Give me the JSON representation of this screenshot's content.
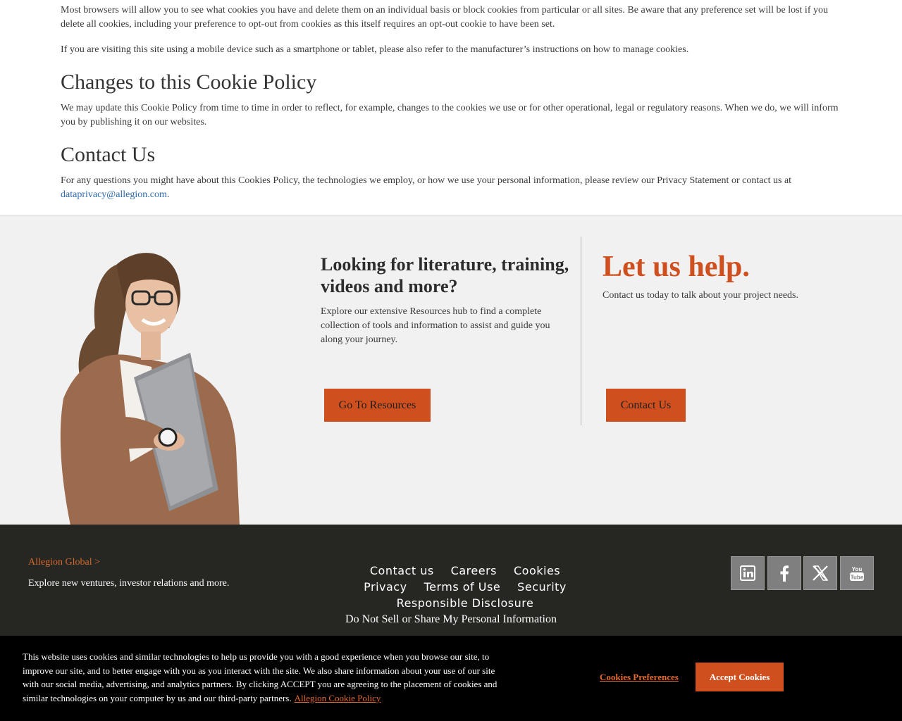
{
  "article": {
    "p1": "Most browsers will allow you to see what cookies you have and delete them on an individual basis or block cookies from particular or all sites. Be aware that any preference set will be lost if you delete all cookies, including your preference to opt-out from cookies as this itself requires an opt-out cookie to have been set.",
    "p2": "If you are visiting this site using a mobile device such as a smartphone or tablet, please also refer to the manufacturer’s instructions on how to manage cookies.",
    "changes_heading": "Changes to this Cookie Policy",
    "p3": "We may update this Cookie Policy from time to time in order to reflect, for example, changes to the cookies we use or for other operational, legal or regulatory reasons. When we do, we will inform you by publishing it on our websites.",
    "contact_heading": "Contact Us",
    "p4_text": "For any questions you might have about this Cookies Policy, the technologies we employ, or how we use your personal information, please review our Privacy Statement or contact us at",
    "p4_email": "dataprivacy@allegion.com",
    "p4_end": "."
  },
  "promo": {
    "resources_title": "Looking for literature, training, videos and more?",
    "resources_text": "Explore our extensive Resources hub to find a complete collection of tools and information to assist and guide you along your journey.",
    "resources_button": "Go To Resources",
    "help_title": "Let us help.",
    "help_text": "Contact us today to talk about your project needs.",
    "contact_button": "Contact Us"
  },
  "footer": {
    "global_link": "Allegion Global >",
    "global_text": "Explore new ventures, investor relations and more.",
    "links_row1": [
      "Contact us",
      "Careers",
      "Cookies"
    ],
    "links_row2": [
      "Privacy",
      "Terms of Use",
      "Security"
    ],
    "links_row3": [
      "Responsible Disclosure"
    ],
    "do_not_sell": "Do Not Sell or Share My Personal Information",
    "social": [
      "linkedin-icon",
      "facebook-icon",
      "x-icon",
      "youtube-icon"
    ]
  },
  "cookie_banner": {
    "text": "This website uses cookies and similar technologies to help us provide you with a good experience when you browse our site, to improve our site, and to better engage with you as you interact with the site. We also share information about your use of our site with our social media, advertising, and analytics partners. By clicking ACCEPT you are agreeing to the placement of cookies and similar technologies on your computer by us and our third-party partners.",
    "policy_link": "Allegion Cookie Policy",
    "preferences": "Cookies Preferences",
    "accept": "Accept Cookies"
  },
  "colors": {
    "accent": "#d04f1f",
    "footer_bg": "#262722",
    "promo_bg": "#f1f1f1",
    "link_blue": "#2b6cb0"
  }
}
